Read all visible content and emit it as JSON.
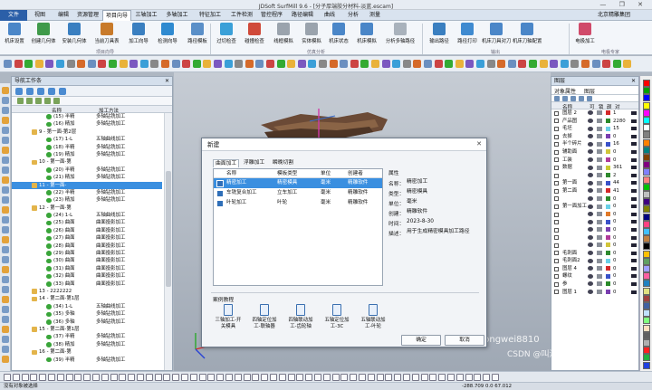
{
  "window": {
    "title": "JDSoft SurfMill 9.6 - [分子厚端胶分材料-淡蓝.escam]",
    "controls": "— ❐ ✕"
  },
  "menu": {
    "items": [
      "文件",
      "视图",
      "编辑",
      "资源管理",
      "项目向导",
      "三轴加工",
      "多轴加工",
      "特征加工",
      "工件检测",
      "管控程序",
      "路径编辑",
      "曲线",
      "分析",
      "测量"
    ],
    "active": "项目向导",
    "user": "北京精雕集团"
  },
  "ribbon": {
    "buttons": [
      "机床设置",
      "创建几何体",
      "安装几何体",
      "当前刀具表",
      "加工向导",
      "检测向导",
      "路径模板",
      "过切检查",
      "碰撞检查",
      "线框模拟",
      "实体模拟",
      "机床状态",
      "机床模拟",
      "分析多轴路径",
      "输出路径",
      "路径打印",
      "机床刀具对刀",
      "机床刀轴配置",
      "电极加工"
    ],
    "groups": [
      "项目向导",
      "仿真分析",
      "输出",
      "电极专家"
    ]
  },
  "nav": {
    "title": "导航工作条",
    "close": "✕",
    "col_name": "名称",
    "col_method": "加工方法",
    "rows": [
      {
        "name": "(15) 半精",
        "method": "多轴钻铣加工"
      },
      {
        "name": "(16) 精加",
        "method": "多轴钻铣加工"
      },
      {
        "name": "9 - 第一面-第2层",
        "method": ""
      },
      {
        "name": "(17) 1-L",
        "method": "五轴曲线加工"
      },
      {
        "name": "(18) 半精",
        "method": "多轴钻铣加工"
      },
      {
        "name": "(19) 精加",
        "method": "多轴钻铣加工"
      },
      {
        "name": "10 - 第一面-第",
        "method": ""
      },
      {
        "name": "(20) 半精",
        "method": "多轴钻铣加工"
      },
      {
        "name": "(21) 精加",
        "method": "多轴钻铣加工"
      },
      {
        "name": "11 - 第一面-",
        "method": ""
      },
      {
        "name": "(22) 半精",
        "method": "多轴钻铣加工"
      },
      {
        "name": "(23) 精加",
        "method": "多轴钻铣加工"
      },
      {
        "name": "12 - 第一面-第",
        "method": ""
      },
      {
        "name": "(24) 1-L",
        "method": "五轴曲线加工"
      },
      {
        "name": "(25) 曲面",
        "method": "曲面投影加工"
      },
      {
        "name": "(26) 曲面",
        "method": "曲面投影加工"
      },
      {
        "name": "(27) 曲面",
        "method": "曲面投影加工"
      },
      {
        "name": "(28) 曲面",
        "method": "曲面投影加工"
      },
      {
        "name": "(29) 曲面",
        "method": "曲面投影加工"
      },
      {
        "name": "(30) 曲面",
        "method": "曲面投影加工"
      },
      {
        "name": "(31) 曲面",
        "method": "曲面投影加工"
      },
      {
        "name": "(32) 曲面",
        "method": "曲面投影加工"
      },
      {
        "name": "(33) 曲面",
        "method": "曲面投影加工"
      },
      {
        "name": "13 - 2222222",
        "method": ""
      },
      {
        "name": "14 - 第二面-第1层",
        "method": ""
      },
      {
        "name": "(34) 1-L",
        "method": "五轴曲线加工"
      },
      {
        "name": "(35) 多轴",
        "method": "多轴钻铣加工"
      },
      {
        "name": "(36) 多轴",
        "method": "多轴钻铣加工"
      },
      {
        "name": "15 - 第二面-第1层",
        "method": ""
      },
      {
        "name": "(37) 半精",
        "method": "多轴钻铣加工"
      },
      {
        "name": "(38) 精加",
        "method": "多轴钻铣加工"
      },
      {
        "name": "16 - 第二面-第",
        "method": ""
      },
      {
        "name": "(39) 半精",
        "method": "多轴钻铣加工"
      }
    ],
    "selected_index": 9
  },
  "layers": {
    "title": "图层",
    "close": "✕",
    "tabs": [
      "对象属性",
      "图层"
    ],
    "headers": [
      "名称",
      "可",
      "锁",
      "颜",
      "对"
    ],
    "rows": [
      {
        "name": "图层 2",
        "num": "1"
      },
      {
        "name": "产品图",
        "num": "2280"
      },
      {
        "name": "毛坯",
        "num": "15"
      },
      {
        "name": "去掉",
        "num": "0"
      },
      {
        "name": "半个碎片",
        "num": "16"
      },
      {
        "name": "辅助面",
        "num": "0"
      },
      {
        "name": "工装",
        "num": "0"
      },
      {
        "name": "数据",
        "num": "361"
      },
      {
        "name": "",
        "num": "2"
      },
      {
        "name": "第一面",
        "num": "44"
      },
      {
        "name": "第二面",
        "num": "41"
      },
      {
        "name": "",
        "num": "0"
      },
      {
        "name": "第一面加工",
        "num": "0"
      },
      {
        "name": "",
        "num": "0"
      },
      {
        "name": "",
        "num": "0"
      },
      {
        "name": "",
        "num": "0"
      },
      {
        "name": "",
        "num": "0"
      },
      {
        "name": "",
        "num": "0"
      },
      {
        "name": "毛刺面",
        "num": "0"
      },
      {
        "name": "毛刺面2",
        "num": "0"
      },
      {
        "name": "图层 4",
        "num": "0"
      },
      {
        "name": "螺纹",
        "num": "0"
      },
      {
        "name": "参",
        "num": "0"
      },
      {
        "name": "图层 1",
        "num": "0"
      }
    ],
    "swatch_colors": [
      "#d42a2a",
      "#2b8a2b",
      "#6ad0e8",
      "#7a3fb0",
      "#3a52c9",
      "#d1c53a",
      "#b03a9a",
      "#c9ca33",
      "#2f8a2f",
      "#3a52c9",
      "#d42a2a",
      "#2b8a2b",
      "#6ad0e8",
      "#e07a2a",
      "#3a52c9",
      "#7a3fb0",
      "#b03a9a",
      "#d1c53a",
      "#2f8a2f",
      "#6ad0e8",
      "#d42a2a",
      "#3a52c9",
      "#2b8a2b",
      "#7a3fb0"
    ]
  },
  "palette": [
    "#ff0000",
    "#00a000",
    "#0000ff",
    "#ffff00",
    "#ff00ff",
    "#00ffff",
    "#ffffff",
    "#808080",
    "#ff8000",
    "#008080",
    "#804000",
    "#800080",
    "#8080ff",
    "#ff8080",
    "#00c000",
    "#c0c0c0",
    "#400080",
    "#808000",
    "#000080",
    "#ff4080",
    "#40c0ff",
    "#c08040",
    "#000000",
    "#ffc000",
    "#60a060",
    "#a0a0ff",
    "#ff60a0",
    "#2080c0",
    "#e0e080",
    "#a04040",
    "#4060a0",
    "#c0e0ff",
    "#80ff80",
    "#ffe0c0",
    "#606060",
    "#b0b0b0",
    "#ff2020",
    "#20b040",
    "#2040e0"
  ],
  "dialog": {
    "title": "新建",
    "close": "✕",
    "tabs": [
      "曲面加工",
      "浮雕加工",
      "瞬晚切割"
    ],
    "active_tab": "曲面加工",
    "list_headers": [
      "名称",
      "模板类型",
      "单位",
      "创建者"
    ],
    "templates": [
      {
        "name": "精密加工",
        "type": "精密模具",
        "unit": "毫米",
        "creator": "精雕软件"
      },
      {
        "name": "车铣复合加工",
        "type": "立车加工",
        "unit": "毫米",
        "creator": "精雕软件"
      },
      {
        "name": "叶轮加工",
        "type": "叶轮",
        "unit": "毫米",
        "creator": "精雕软件"
      }
    ],
    "selected_template": 0,
    "props_header": "属性",
    "props": [
      {
        "k": "名称：",
        "v": "精密加工"
      },
      {
        "k": "类型：",
        "v": "精密模具"
      },
      {
        "k": "单位：",
        "v": "毫米"
      },
      {
        "k": "创建：",
        "v": "精雕软件"
      },
      {
        "k": "时间：",
        "v": "2023-8-30"
      },
      {
        "k": "描述：",
        "v": "用于生成精密模具加工路径"
      }
    ],
    "cases_header": "案例教程",
    "cases": [
      {
        "l1": "三轴加工-开",
        "l2": "关模具"
      },
      {
        "l1": "四轴定位加",
        "l2": "工-联轴器"
      },
      {
        "l1": "四轴联动加",
        "l2": "工-齿轮轴"
      },
      {
        "l1": "五轴定位加",
        "l2": "工-3C"
      },
      {
        "l1": "五轴联动加",
        "l2": "工-叶轮"
      }
    ],
    "ok": "确定",
    "cancel": "取消"
  },
  "status": {
    "left": "没有对象被选择",
    "coords": "-288.709  0.0  67.012"
  },
  "watermark": {
    "a": "知乎 @Nianhongwei8810",
    "b": "CSDN @叫洵果子"
  }
}
